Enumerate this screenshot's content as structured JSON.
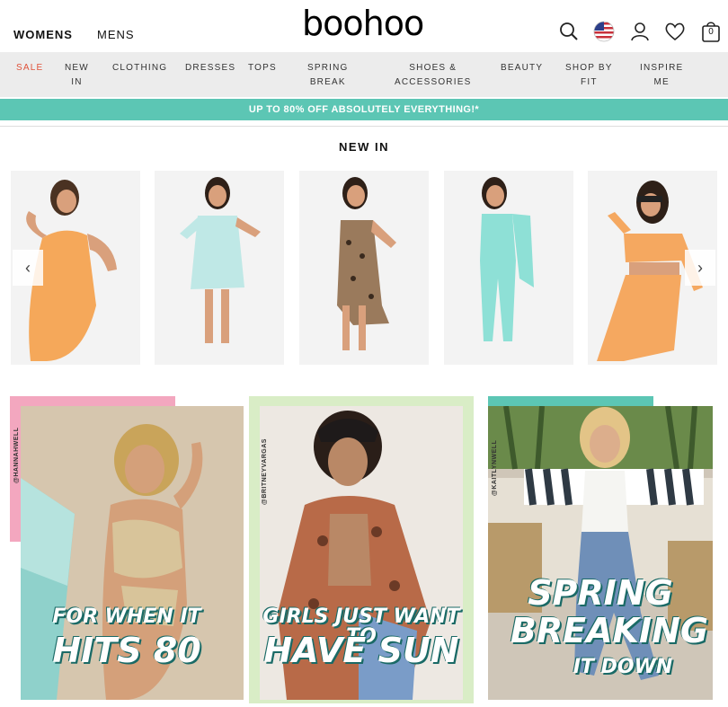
{
  "header": {
    "womens": "WOMENS",
    "mens": "MENS",
    "logo": "boohoo",
    "bag_count": "0"
  },
  "nav": {
    "items": [
      {
        "label": "SALE"
      },
      {
        "label": "NEW\nIN"
      },
      {
        "label": "CLOTHING"
      },
      {
        "label": "DRESSES"
      },
      {
        "label": "TOPS"
      },
      {
        "label": "SPRING\nBREAK"
      },
      {
        "label": "SHOES &\nACCESSORIES"
      },
      {
        "label": "BEAUTY"
      },
      {
        "label": "SHOP BY\nFIT"
      },
      {
        "label": "INSPIRE\nME"
      }
    ]
  },
  "promo": "UP TO 80% OFF ABSOLUTELY EVERYTHING!*",
  "new_in": {
    "title": "NEW IN",
    "products": [
      {
        "outfit": "orange one-shoulder ruched mini dress",
        "color": "#f5a85a"
      },
      {
        "outfit": "mint wrap mini dress",
        "color": "#bfe8e6"
      },
      {
        "outfit": "leopard print asymmetric dress",
        "color": "#9a7a5c"
      },
      {
        "outfit": "mint cape jumpsuit",
        "color": "#8ee0d6"
      },
      {
        "outfit": "orange crop top and skirt co-ord",
        "color": "#f5a860"
      }
    ]
  },
  "tiles": [
    {
      "handle": "@HANNAHWELL",
      "line1": "FOR WHEN IT",
      "line2": "HITS 80",
      "accent": "#f3a7bf"
    },
    {
      "handle": "@BRITNEYVARGAS",
      "line1": "GIRLS JUST WANT TO",
      "line2": "HAVE SUN",
      "accent": "#d9edc6"
    },
    {
      "handle": "@KAITLYNWELL",
      "line1": "SPRING",
      "line2": "BREAKING",
      "line3": "IT DOWN",
      "accent": "#5cc6b4"
    }
  ],
  "colors": {
    "accent": "#5cc6b4",
    "sale": "#e0523a",
    "nav_bg": "#ececec"
  }
}
